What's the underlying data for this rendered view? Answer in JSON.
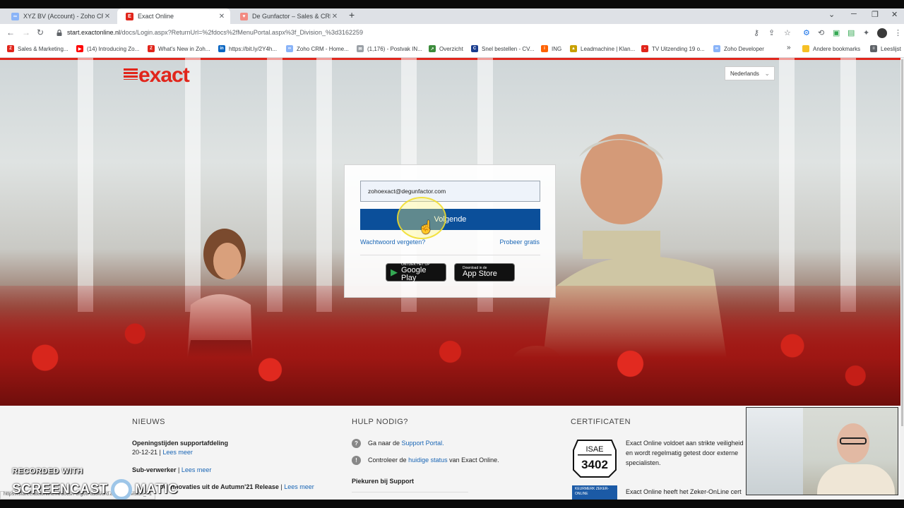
{
  "browser": {
    "tabs": [
      {
        "title": "XYZ BV (Account) - Zoho CRM",
        "active": false
      },
      {
        "title": "Exact Online",
        "active": true
      },
      {
        "title": "De Gunfactor – Sales & CRM con",
        "active": false
      }
    ],
    "url_host": "start.exactonline.nl",
    "url_rest": "/docs/Login.aspx?ReturnUrl=%2fdocs%2fMenuPortal.aspx%3f_Division_%3d3162259",
    "bookmarks": [
      "Sales & Marketing...",
      "(14) Introducing Zo...",
      "What's New in Zoh...",
      "https://bit.ly/2Y4h...",
      "Zoho CRM - Home...",
      "(1,176) - Postvak IN...",
      "Overzicht",
      "Snel bestellen - CV...",
      "ING",
      "Leadmachine | Klan...",
      "TV Uitzending 19 o...",
      "Zoho Developer"
    ],
    "other_bookmarks": "Andere bookmarks",
    "reading_list": "Leeslijst",
    "more_bookmarks": "»",
    "status_url": "https://start.exactonline.nl/docs/ForgotPassword.aspx?_Division_=1"
  },
  "page": {
    "logo": "exact",
    "language": "Nederlands",
    "login": {
      "email_value": "zohoexact@degunfactor.com",
      "next_label": "Volgende",
      "forgot_label": "Wachtwoord vergeten?",
      "trial_label": "Probeer gratis",
      "google_small": "ONTDEK HET OP",
      "google_big": "Google Play",
      "apple_small": "Download in de",
      "apple_big": "App Store"
    },
    "news": {
      "heading": "NIEUWS",
      "item1_title": "Openingstijden supportafdeling",
      "item1_date": "20-12-21 |",
      "item1_link": "Lees meer",
      "item2_title": "Sub-verwerker",
      "item2_link": "Lees meer",
      "item3_title": "De innovaties uit de Autumn'21 Release",
      "item3_link": "Lees meer"
    },
    "help": {
      "heading": "HULP NODIG?",
      "line1_pre": "Ga naar de",
      "line1_link": "Support Portal.",
      "line2_pre": "Controleer de",
      "line2_link": "huidige status",
      "line2_post": "van Exact Online.",
      "peak": "Piekuren bij Support"
    },
    "certs": {
      "heading": "CERTIFICATEN",
      "isae_top": "ISAE",
      "isae_num": "3402",
      "text1a": "Exact Online voldoet aan strikte veiligheid",
      "text1b": "en wordt regelmatig getest door externe",
      "text1c": "specialisten.",
      "keurmerk": "KEURMERK ZEKER-ONLINE",
      "text2": "Exact Online heeft het Zeker-OnLine cert"
    }
  },
  "watermark": {
    "line1": "RECORDED WITH",
    "line2a": "SCREENCAST",
    "line2b": "MATIC"
  },
  "colors": {
    "brand_red": "#e1251b",
    "button_blue": "#0b4f9a",
    "link_blue": "#1a66b5"
  }
}
